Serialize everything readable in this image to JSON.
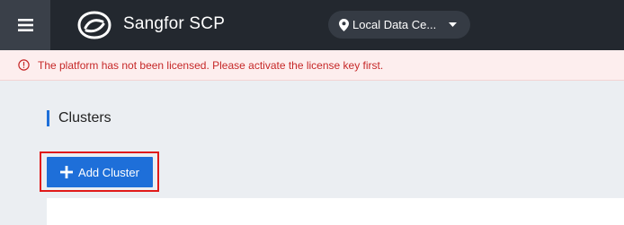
{
  "header": {
    "brand": "Sangfor SCP",
    "datacenter": "Local Data Ce..."
  },
  "alert": {
    "message": "The platform has not been licensed. Please activate the license key first."
  },
  "page": {
    "title": "Clusters",
    "add_button_label": "Add Cluster"
  },
  "icons": {
    "menu": "hamburger-menu-icon",
    "logo": "sangfor-logo",
    "location": "map-pin-icon",
    "dropdown": "caret-down-icon",
    "alert": "info-circle-icon",
    "add": "plus-icon"
  },
  "colors": {
    "topbar": "#23282f",
    "accent": "#1e6fd9",
    "alert_text": "#c62828",
    "alert_bg": "#fdeeee",
    "highlight": "#e11a1a"
  }
}
